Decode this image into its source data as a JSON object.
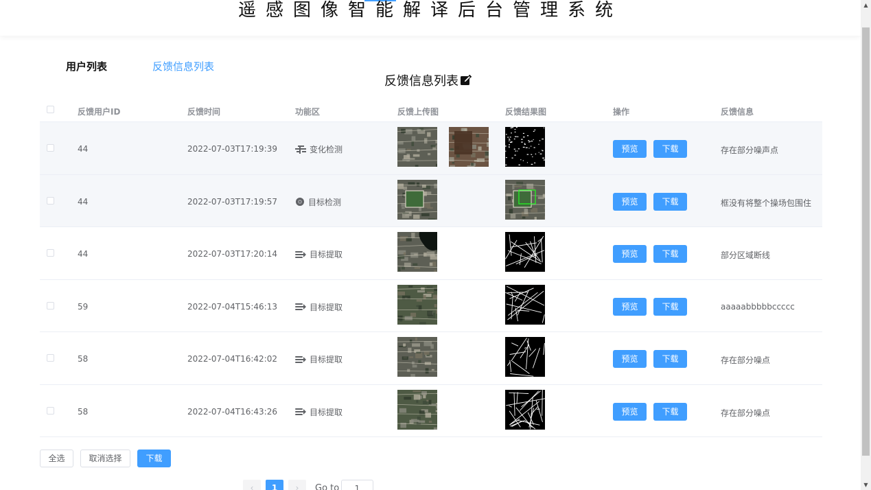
{
  "header": {
    "title": "遥感图像智能解译后台管理系统"
  },
  "tabs": [
    {
      "label": "用户列表",
      "active": false
    },
    {
      "label": "反馈信息列表",
      "active": true
    }
  ],
  "section": {
    "title": "反馈信息列表",
    "icon": "edit-icon"
  },
  "table": {
    "columns": [
      "反馈用户ID",
      "反馈时间",
      "功能区",
      "反馈上传图",
      "反馈结果图",
      "操作",
      "反馈信息"
    ],
    "actions": {
      "preview": "预览",
      "download": "下载"
    },
    "rows": [
      {
        "id": "44",
        "time": "2022-07-03T17:19:39",
        "func": "变化检测",
        "func_icon": "change-detect-icon",
        "message": "存在部分噪声点",
        "uploads": 2
      },
      {
        "id": "44",
        "time": "2022-07-03T17:19:57",
        "func": "目标检测",
        "func_icon": "target-detect-icon",
        "message": "框没有将整个操场包围住",
        "uploads": 1
      },
      {
        "id": "44",
        "time": "2022-07-03T17:20:14",
        "func": "目标提取",
        "func_icon": "extract-icon",
        "message": "部分区域断线",
        "uploads": 1
      },
      {
        "id": "59",
        "time": "2022-07-04T15:46:13",
        "func": "目标提取",
        "func_icon": "extract-icon",
        "message": "aaaaabbbbbccccc",
        "uploads": 1
      },
      {
        "id": "58",
        "time": "2022-07-04T16:42:02",
        "func": "目标提取",
        "func_icon": "extract-icon",
        "message": "存在部分噪点",
        "uploads": 1
      },
      {
        "id": "58",
        "time": "2022-07-04T16:43:26",
        "func": "目标提取",
        "func_icon": "extract-icon",
        "message": "存在部分噪点",
        "uploads": 1
      }
    ]
  },
  "bottom": {
    "select_all": "全选",
    "deselect": "取消选择",
    "download": "下载"
  },
  "pagination": {
    "prev": "‹",
    "current": "1",
    "next": "›",
    "goto_label": "Go to",
    "goto_value": "1"
  },
  "colors": {
    "primary": "#409eff",
    "header_text": "#909399",
    "body_text": "#606266",
    "row_alt": "#f5f7fa"
  }
}
